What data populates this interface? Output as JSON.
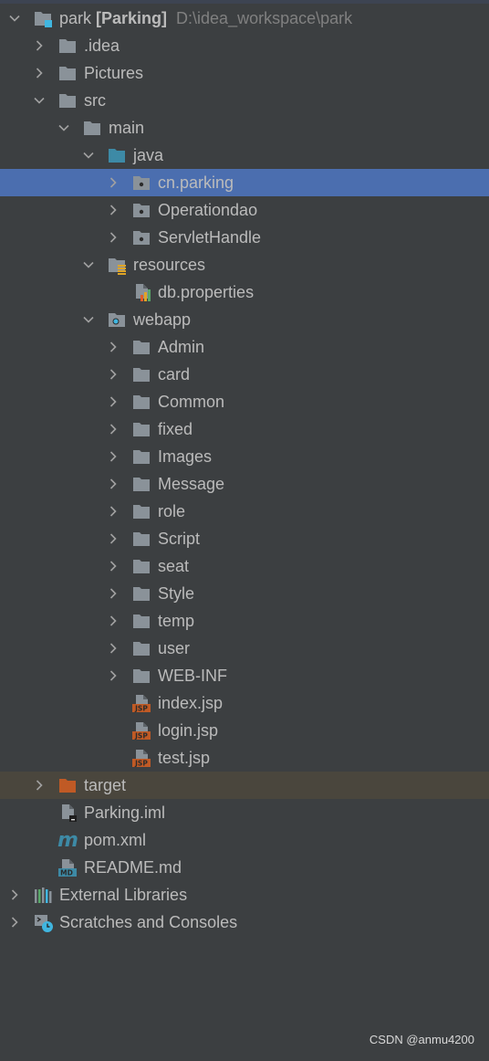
{
  "colors": {
    "background": "#3c3f41",
    "selected": "#4b6eaf",
    "excluded": "#4a463d",
    "text": "#bbbbbb",
    "folder": "#8a9299",
    "source_folder": "#3d8aa6",
    "excluded_folder": "#c05a25"
  },
  "project": {
    "name": "park",
    "module": "[Parking]",
    "path": "D:\\idea_workspace\\park"
  },
  "tree": [
    {
      "level": 0,
      "state": "expanded",
      "icon": "project-folder-icon",
      "label": "park",
      "project": true
    },
    {
      "level": 1,
      "state": "collapsed",
      "icon": "folder-icon",
      "label": ".idea"
    },
    {
      "level": 1,
      "state": "collapsed",
      "icon": "folder-icon",
      "label": "Pictures"
    },
    {
      "level": 1,
      "state": "expanded",
      "icon": "folder-icon",
      "label": "src"
    },
    {
      "level": 2,
      "state": "expanded",
      "icon": "folder-icon",
      "label": "main"
    },
    {
      "level": 3,
      "state": "expanded",
      "icon": "source-folder-icon",
      "label": "java"
    },
    {
      "level": 4,
      "state": "collapsed",
      "icon": "package-icon",
      "label": "cn.parking",
      "selected": true
    },
    {
      "level": 4,
      "state": "collapsed",
      "icon": "package-icon",
      "label": "Operationdao"
    },
    {
      "level": 4,
      "state": "collapsed",
      "icon": "package-icon",
      "label": "ServletHandle"
    },
    {
      "level": 3,
      "state": "expanded",
      "icon": "resources-folder-icon",
      "label": "resources"
    },
    {
      "level": 4,
      "state": "leaf",
      "icon": "properties-file-icon",
      "label": "db.properties"
    },
    {
      "level": 3,
      "state": "expanded",
      "icon": "web-folder-icon",
      "label": "webapp"
    },
    {
      "level": 4,
      "state": "collapsed",
      "icon": "folder-icon",
      "label": "Admin"
    },
    {
      "level": 4,
      "state": "collapsed",
      "icon": "folder-icon",
      "label": "card"
    },
    {
      "level": 4,
      "state": "collapsed",
      "icon": "folder-icon",
      "label": "Common"
    },
    {
      "level": 4,
      "state": "collapsed",
      "icon": "folder-icon",
      "label": "fixed"
    },
    {
      "level": 4,
      "state": "collapsed",
      "icon": "folder-icon",
      "label": "Images"
    },
    {
      "level": 4,
      "state": "collapsed",
      "icon": "folder-icon",
      "label": "Message"
    },
    {
      "level": 4,
      "state": "collapsed",
      "icon": "folder-icon",
      "label": "role"
    },
    {
      "level": 4,
      "state": "collapsed",
      "icon": "folder-icon",
      "label": "Script"
    },
    {
      "level": 4,
      "state": "collapsed",
      "icon": "folder-icon",
      "label": "seat"
    },
    {
      "level": 4,
      "state": "collapsed",
      "icon": "folder-icon",
      "label": "Style"
    },
    {
      "level": 4,
      "state": "collapsed",
      "icon": "folder-icon",
      "label": "temp"
    },
    {
      "level": 4,
      "state": "collapsed",
      "icon": "folder-icon",
      "label": "user"
    },
    {
      "level": 4,
      "state": "collapsed",
      "icon": "folder-icon",
      "label": "WEB-INF"
    },
    {
      "level": 4,
      "state": "leaf",
      "icon": "jsp-file-icon",
      "label": "index.jsp"
    },
    {
      "level": 4,
      "state": "leaf",
      "icon": "jsp-file-icon",
      "label": "login.jsp"
    },
    {
      "level": 4,
      "state": "leaf",
      "icon": "jsp-file-icon",
      "label": "test.jsp"
    },
    {
      "level": 1,
      "state": "collapsed",
      "icon": "excluded-folder-icon",
      "label": "target",
      "excluded": true
    },
    {
      "level": 1,
      "state": "leaf",
      "icon": "iml-file-icon",
      "label": "Parking.iml"
    },
    {
      "level": 1,
      "state": "leaf",
      "icon": "maven-file-icon",
      "label": "pom.xml"
    },
    {
      "level": 1,
      "state": "leaf",
      "icon": "markdown-file-icon",
      "label": "README.md"
    },
    {
      "level": 0,
      "state": "collapsed",
      "icon": "libraries-icon",
      "label": "External Libraries"
    },
    {
      "level": 0,
      "state": "collapsed",
      "icon": "scratches-icon",
      "label": "Scratches and Consoles"
    }
  ],
  "watermark": "CSDN @anmu4200"
}
